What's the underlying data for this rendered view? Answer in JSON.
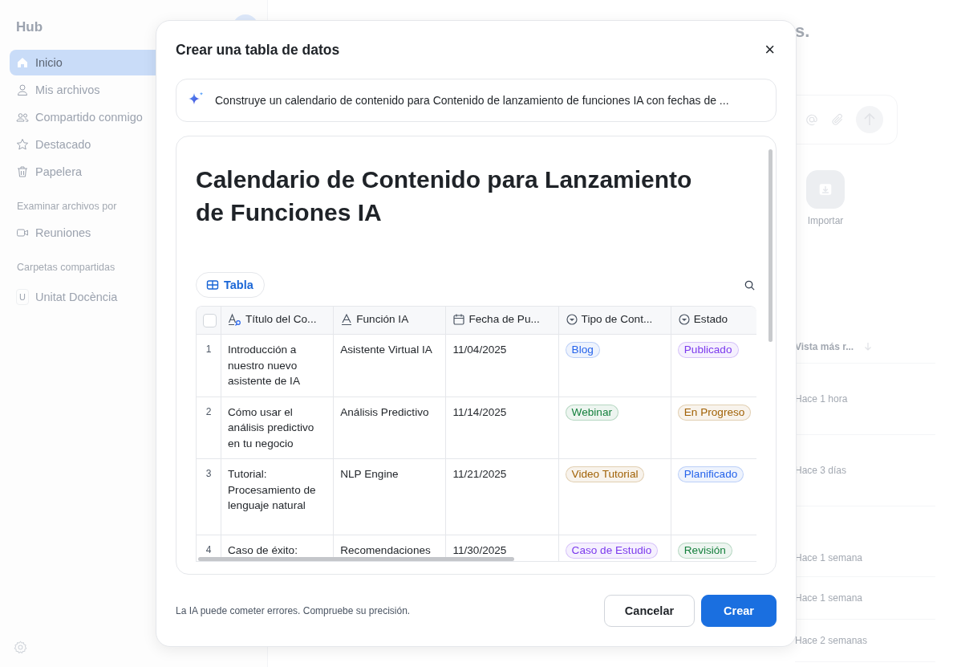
{
  "sidebar": {
    "title": "Hub",
    "items": [
      {
        "label": "Inicio",
        "selected": true
      },
      {
        "label": "Mis archivos",
        "selected": false
      },
      {
        "label": "Compartido conmigo",
        "selected": false
      },
      {
        "label": "Destacado",
        "selected": false
      },
      {
        "label": "Papelera",
        "selected": false
      }
    ],
    "browse_heading": "Examinar archivos por",
    "browse_items": [
      {
        "label": "Reuniones",
        "selected": false
      }
    ],
    "shared_heading": "Carpetas compartidas",
    "shared_folders": [
      {
        "initial": "U",
        "label": "Unitat Docència"
      }
    ]
  },
  "main": {
    "heading": "s.",
    "import_label": "Importar",
    "list_header": "Vista más r...",
    "list_rows": [
      "Hace 1 hora",
      "Hace 3 días",
      "Hace 1 semana",
      "Hace 1 semana",
      "Hace 2 semanas"
    ]
  },
  "dialog": {
    "title": "Crear una tabla de datos",
    "close": "×",
    "prompt": "Construye un calendario de contenido para Contenido de lanzamiento de funciones IA con fechas de ...",
    "preview": {
      "heading": "Calendario de Contenido para Lanzamiento de Funciones IA",
      "view_tab": "Tabla",
      "table": {
        "all_checked": false,
        "columns": [
          "Título del Co...",
          "Función IA",
          "Fecha de Pu...",
          "Tipo de Cont...",
          "Estado"
        ],
        "rows": [
          {
            "number": "1",
            "title": "Introducción a nuestro nuevo asistente de IA",
            "function": "Asistente Virtual IA",
            "date": "11/04/2025",
            "type": {
              "label": "Blog",
              "color": "#2563eb"
            },
            "status": {
              "label": "Publicado",
              "color": "#7c3aed"
            }
          },
          {
            "number": "2",
            "title": "Cómo usar el análisis predictivo en tu negocio",
            "function": "Análisis Predictivo",
            "date": "11/14/2025",
            "type": {
              "label": "Webinar",
              "color": "#15803d"
            },
            "status": {
              "label": "En Progreso",
              "color": "#a16207"
            }
          },
          {
            "number": "3",
            "title": "Tutorial: Procesamiento de lenguaje natural",
            "function": "NLP Engine",
            "date": "11/21/2025",
            "type": {
              "label": "Video Tutorial",
              "color": "#a16207"
            },
            "status": {
              "label": "Planificado",
              "color": "#2563eb"
            }
          },
          {
            "number": "4",
            "title": "Caso de éxito:",
            "function": "Recomendaciones",
            "date": "11/30/2025",
            "type": {
              "label": "Caso de Estudio",
              "color": "#7c3aed"
            },
            "status": {
              "label": "Revisión",
              "color": "#15803d"
            }
          }
        ]
      }
    },
    "disclaimer": "La IA puede cometer errores. Compruebe su precisión.",
    "buttons": [
      {
        "label": "Cancelar",
        "kind": "secondary"
      },
      {
        "label": "Crear",
        "kind": "primary"
      }
    ]
  }
}
